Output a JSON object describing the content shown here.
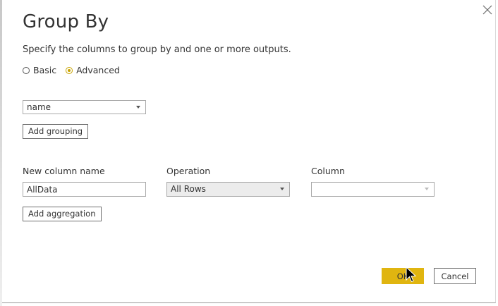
{
  "dialog": {
    "title": "Group By",
    "description": "Specify the columns to group by and one or more outputs."
  },
  "mode": {
    "options": [
      {
        "label": "Basic",
        "selected": false
      },
      {
        "label": "Advanced",
        "selected": true
      }
    ]
  },
  "grouping": {
    "column_value": "name",
    "add_label": "Add grouping"
  },
  "aggregation": {
    "headers": {
      "new_column_name": "New column name",
      "operation": "Operation",
      "column": "Column"
    },
    "row": {
      "new_column_name": "AllData",
      "operation": "All Rows",
      "column": ""
    },
    "add_label": "Add aggregation"
  },
  "footer": {
    "ok_label": "OK",
    "cancel_label": "Cancel"
  },
  "colors": {
    "accent": "#e0b510",
    "radio_selected": "#c8a300"
  }
}
